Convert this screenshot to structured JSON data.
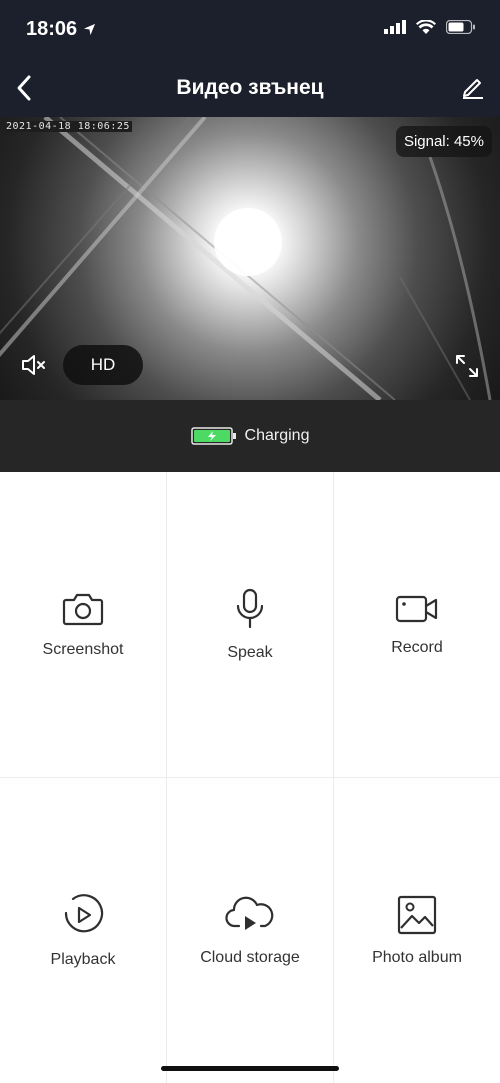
{
  "status_bar": {
    "time": "18:06"
  },
  "header": {
    "title": "Видео звънец"
  },
  "video": {
    "timestamp": "2021-04-18  18:06:25",
    "signal_text": "Signal: 45%",
    "quality_label": "HD"
  },
  "power": {
    "status": "Charging",
    "battery_color": "#4cd964"
  },
  "actions": [
    {
      "label": "Screenshot",
      "icon": "camera-icon"
    },
    {
      "label": "Speak",
      "icon": "microphone-icon"
    },
    {
      "label": "Record",
      "icon": "video-camera-icon"
    },
    {
      "label": "Playback",
      "icon": "playback-icon"
    },
    {
      "label": "Cloud storage",
      "icon": "cloud-play-icon"
    },
    {
      "label": "Photo album",
      "icon": "image-icon"
    }
  ]
}
